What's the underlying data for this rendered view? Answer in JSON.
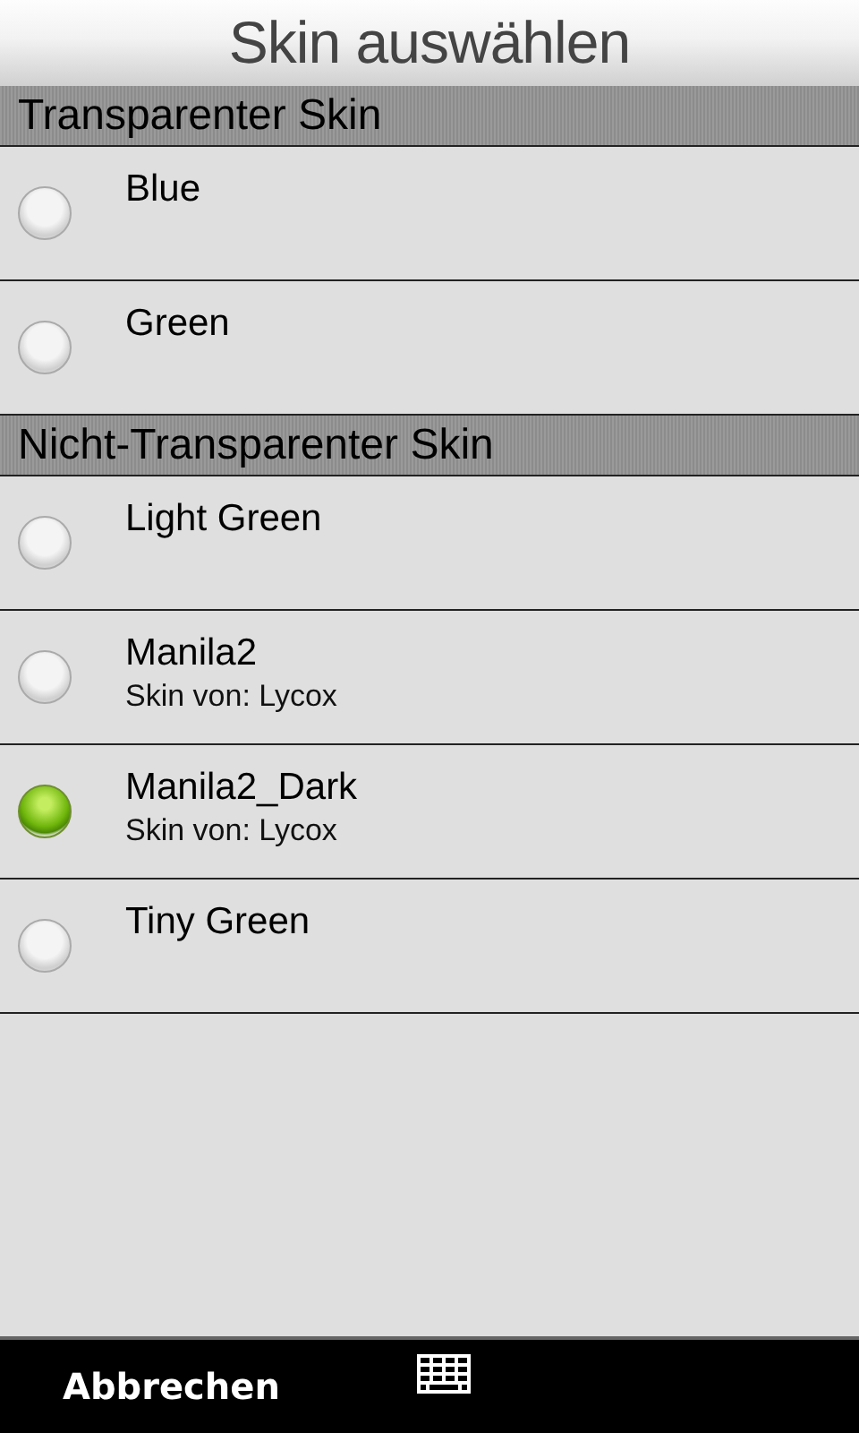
{
  "window": {
    "title": "Skin auswählen"
  },
  "sections": [
    {
      "title": "Transparenter Skin",
      "items": [
        {
          "name": "Blue",
          "selected": false
        },
        {
          "name": "Green",
          "selected": false
        }
      ]
    },
    {
      "title": "Nicht-Transparenter Skin",
      "items": [
        {
          "name": "Light Green",
          "selected": false
        },
        {
          "name": "Manila2",
          "author": "Skin von: Lycox",
          "selected": false
        },
        {
          "name": "Manila2_Dark",
          "author": "Skin von: Lycox",
          "selected": true
        },
        {
          "name": "Tiny Green",
          "selected": false
        }
      ]
    }
  ],
  "bottom_bar": {
    "cancel": "Abbrechen"
  }
}
